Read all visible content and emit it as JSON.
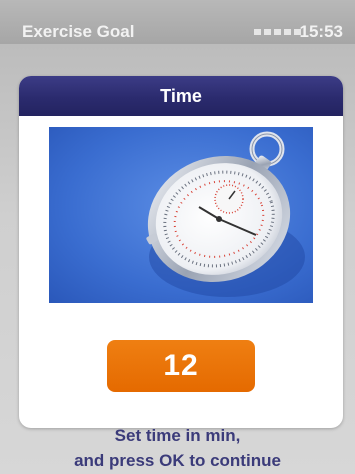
{
  "statusbar": {
    "app_title": "Exercise Goal",
    "clock": "15:53"
  },
  "dialog": {
    "title": "Time",
    "image_icon": "stopwatch-photo",
    "value": "12"
  },
  "hint": {
    "line1": "Set time in min,",
    "line2": "and press OK to continue"
  },
  "colors": {
    "titlebar": "#2b2b6e",
    "value_box": "#e56a00",
    "photo_bg": "#3d6fd0",
    "hint_text": "#3b3b7a"
  }
}
